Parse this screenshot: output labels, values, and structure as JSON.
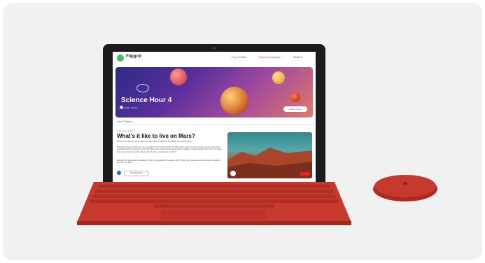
{
  "app": {
    "brand": "Flipgrid"
  },
  "topnav": {
    "link1": "Copy Gridlink",
    "link2": "Record a Response",
    "link3": "Sheila K."
  },
  "hero": {
    "title": "Science Hour 4",
    "subtitle": "by Mrs. Brown",
    "follow": "Follow Group",
    "more": "···"
  },
  "subtabs": {
    "label": "View 4 Topics ⌄"
  },
  "topic": {
    "date": "September 9, 2020",
    "title": "What's it like to live on Mars?",
    "para1": "NASA is now planning for a mission to Mars, which is slated for the 2030s. This could be you!",
    "para2": "The idea of living on Mars has been a staple of science fiction since the 19th century, when American astronomer Percival Lowell speculated that the channels on the Red Planet were really ancient canals built by intelligent extraterrestrials. But if the sci-fi dream were to ever become reality, what would it be like to actually live on Mars?",
    "para3": "Research the atmospheric conditions of Mars: is it suitable for humans to live? Record your response and share what it would be like to live on Mars.",
    "action": "New Response"
  },
  "colors": {
    "accent": "#1a6fc9",
    "keyboard": "#c7382d",
    "bezel": "#1b1b1d",
    "brand_green": "#3cc25a"
  }
}
